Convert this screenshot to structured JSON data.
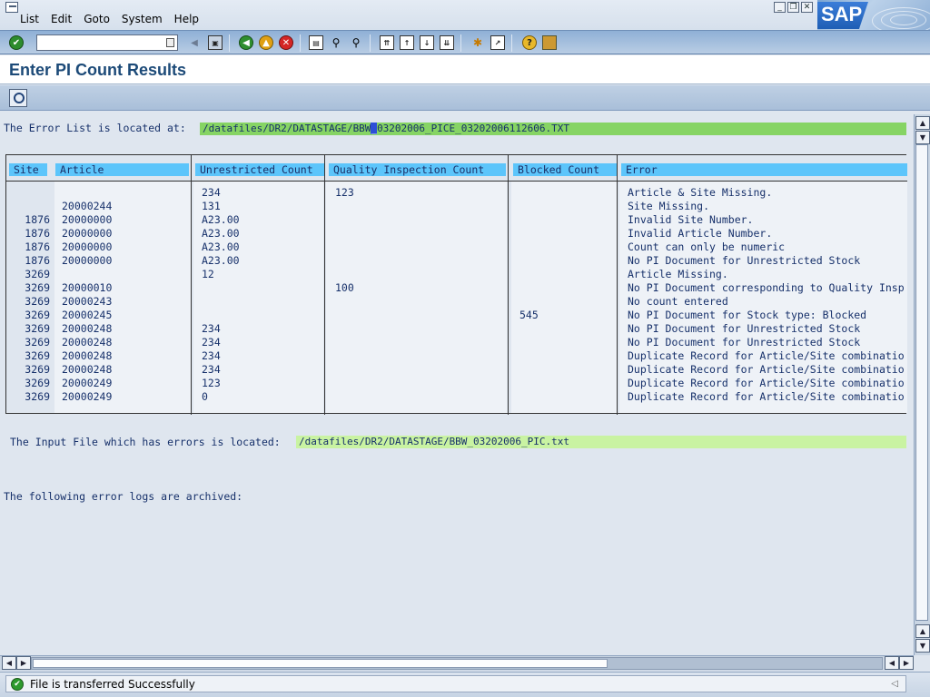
{
  "menu": {
    "items": [
      {
        "name": "list",
        "label": "List"
      },
      {
        "name": "edit",
        "label": "Edit"
      },
      {
        "name": "goto",
        "label": "Goto"
      },
      {
        "name": "system",
        "label": "System"
      },
      {
        "name": "help",
        "label": "Help"
      }
    ]
  },
  "brand": {
    "logo_text": "SAP"
  },
  "toolbar": {
    "command_field_value": ""
  },
  "page": {
    "title": "Enter PI Count Results"
  },
  "content": {
    "error_list_label": "The Error List is located at:",
    "error_list_path_before_cursor": "/datafiles/DR2/DATASTAGE/BBW",
    "error_list_path_cursor": "_",
    "error_list_path_after_cursor": "03202006_PICE_03202006112606.TXT",
    "input_file_label": "The Input File which has errors is located:",
    "input_file_path": "/datafiles/DR2/DATASTAGE/BBW_03202006_PIC.txt",
    "archived_label": "The following error logs are archived:"
  },
  "table": {
    "columns": [
      "Site",
      "Article",
      "Unrestricted Count",
      "Quality Inspection Count",
      "Blocked Count",
      "Error"
    ],
    "rows": [
      [
        "",
        "",
        "234",
        "123",
        "",
        "Article & Site Missing."
      ],
      [
        "",
        "20000244",
        "131",
        "",
        "",
        "Site Missing."
      ],
      [
        "1876",
        "20000000",
        "A23.00",
        "",
        "",
        "Invalid Site Number."
      ],
      [
        "1876",
        "20000000",
        "A23.00",
        "",
        "",
        "Invalid Article Number."
      ],
      [
        "1876",
        "20000000",
        "A23.00",
        "",
        "",
        "Count can only be numeric"
      ],
      [
        "1876",
        "20000000",
        "A23.00",
        "",
        "",
        "No PI Document for Unrestricted Stock"
      ],
      [
        "3269",
        "",
        "12",
        "",
        "",
        "Article Missing."
      ],
      [
        "3269",
        "20000010",
        "",
        "100",
        "",
        "No PI Document corresponding to Quality Insp"
      ],
      [
        "3269",
        "20000243",
        "",
        "",
        "",
        "No count entered"
      ],
      [
        "3269",
        "20000245",
        "",
        "",
        "545",
        "No PI Document for Stock type: Blocked"
      ],
      [
        "3269",
        "20000248",
        "234",
        "",
        "",
        "No PI Document for Unrestricted Stock"
      ],
      [
        "3269",
        "20000248",
        "234",
        "",
        "",
        "No PI Document for Unrestricted Stock"
      ],
      [
        "3269",
        "20000248",
        "234",
        "",
        "",
        "Duplicate Record for Article/Site combinatio"
      ],
      [
        "3269",
        "20000248",
        "234",
        "",
        "",
        "Duplicate Record for Article/Site combinatio"
      ],
      [
        "3269",
        "20000249",
        "123",
        "",
        "",
        "Duplicate Record for Article/Site combinatio"
      ],
      [
        "3269",
        "20000249",
        "0",
        "",
        "",
        "Duplicate Record for Article/Site combinatio"
      ]
    ]
  },
  "status": {
    "message": "File is transferred Successfully",
    "type": "success"
  },
  "colors": {
    "header_cell": "#5cc5fb",
    "path_highlight": "#86d464",
    "path_highlight_light": "#c9f3a2",
    "title": "#1c4a78"
  }
}
